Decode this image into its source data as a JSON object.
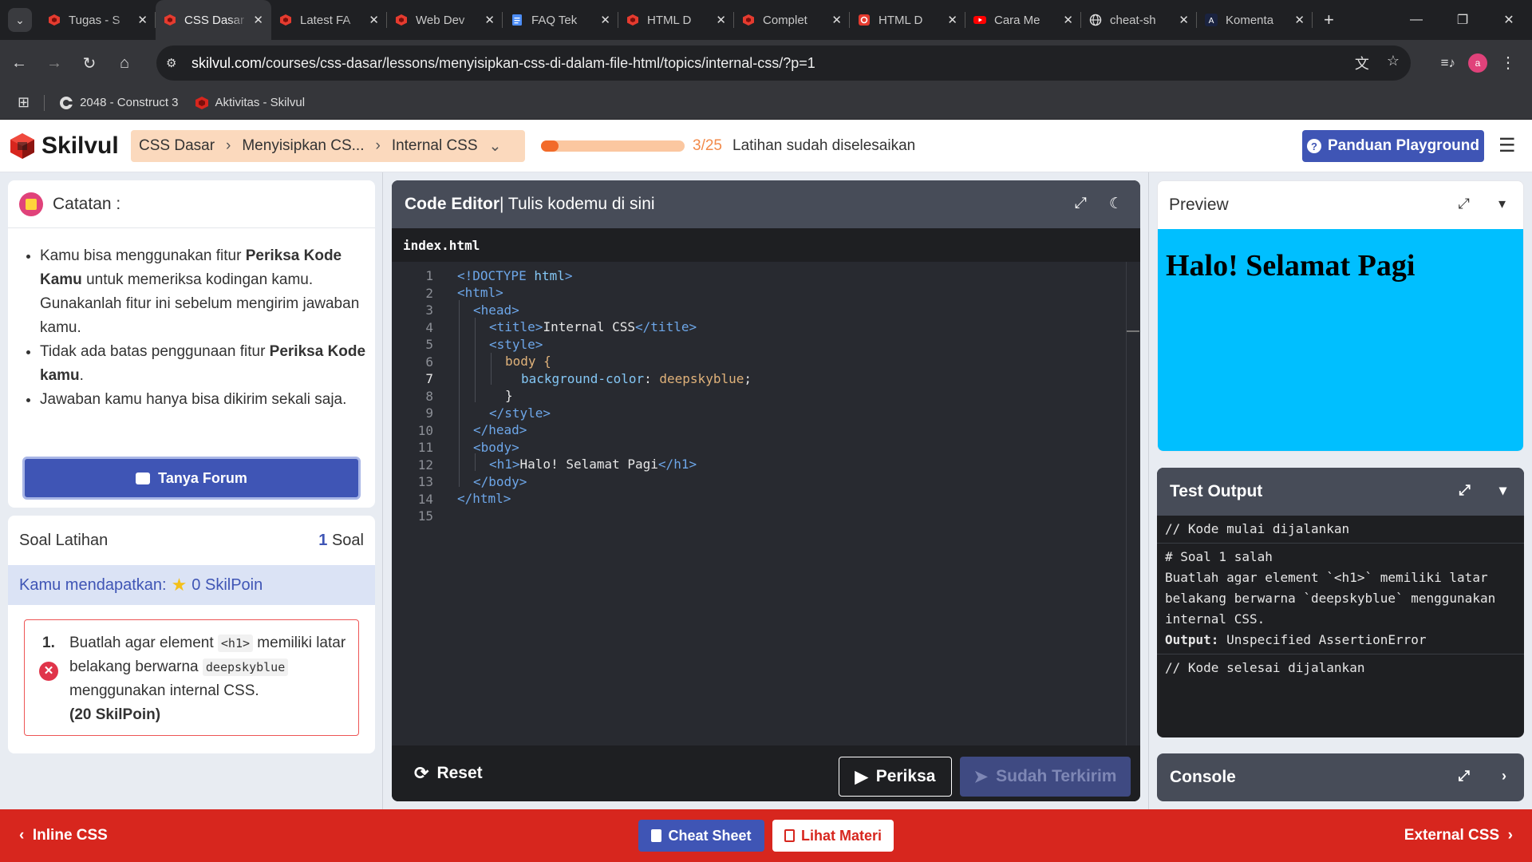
{
  "browser": {
    "tabs": [
      {
        "label": "Tugas - S",
        "icon": "skilvul-icon"
      },
      {
        "label": "CSS Dasar",
        "icon": "skilvul-icon",
        "active": true
      },
      {
        "label": "Latest FA",
        "icon": "skilvul-icon"
      },
      {
        "label": "Web Dev",
        "icon": "skilvul-icon"
      },
      {
        "label": "FAQ Tek",
        "icon": "docs-icon"
      },
      {
        "label": "HTML D",
        "icon": "skilvul-icon"
      },
      {
        "label": "Complet",
        "icon": "skilvul-icon"
      },
      {
        "label": "HTML D",
        "icon": "skilvul-gear-icon"
      },
      {
        "label": "Cara Me",
        "icon": "youtube-icon"
      },
      {
        "label": "cheat-sh",
        "icon": "globe-icon"
      },
      {
        "label": "Komenta",
        "icon": "a-icon"
      }
    ],
    "url_host": "skilvul.com",
    "url_path": "/courses/css-dasar/lessons/menyisipkan-css-di-dalam-file-html/topics/internal-css/?p=1",
    "avatar_letter": "a",
    "bookmarks": [
      {
        "label": "2048 - Construct 3",
        "icon": "construct-icon"
      },
      {
        "label": "Aktivitas - Skilvul",
        "icon": "skilvul-icon"
      }
    ]
  },
  "header": {
    "logo": "Skilvul",
    "breadcrumbs": [
      "CSS Dasar",
      "Menyisipkan CS...",
      "Internal CSS"
    ],
    "progress": {
      "done": 3,
      "total": 25,
      "label": "3/25",
      "text": "Latihan sudah diselesaikan"
    },
    "guide_button": "Panduan Playground"
  },
  "notes": {
    "title": "Catatan :",
    "items": [
      {
        "a": "Kamu bisa menggunakan fitur ",
        "b": "Periksa Kode Kamu",
        "c": " untuk memeriksa kodingan kamu. Gunakanlah fitur ini sebelum mengirim jawaban kamu."
      },
      {
        "a": "Tidak ada batas penggunaan fitur ",
        "b": "Periksa Kode kamu",
        "c": "."
      },
      {
        "a": "Jawaban kamu hanya bisa dikirim sekali saja.",
        "b": "",
        "c": ""
      }
    ],
    "forum_button": "Tanya Forum"
  },
  "exercise": {
    "title": "Soal Latihan",
    "count_num": "1",
    "count_label": " Soal",
    "points_label": "Kamu mendapatkan:",
    "points_value": "0 SkilPoin",
    "task": {
      "number": "1.",
      "text_a": "Buatlah agar element ",
      "code_a": "<h1>",
      "text_b": " memiliki latar belakang berwarna ",
      "code_b": "deepskyblue",
      "text_c": " menggunakan internal CSS.",
      "reward": "(20 SkilPoin)"
    }
  },
  "editor": {
    "title": "Code Editor",
    "subtitle": " | Tulis kodemu di sini",
    "filename": "index.html",
    "lines": [
      "1",
      "2",
      "3",
      "4",
      "5",
      "6",
      "7",
      "8",
      "9",
      "10",
      "11",
      "12",
      "13",
      "14",
      "15"
    ],
    "code": {
      "l1a": "<!DOCTYPE ",
      "l1b": "html",
      "l1c": ">",
      "l2": "<html>",
      "l3": "<head>",
      "l4a": "<title>",
      "l4b": "Internal CSS",
      "l4c": "</title>",
      "l5": "<style>",
      "l6": "body {",
      "l7a": "background-color",
      "l7b": ": ",
      "l7c": "deepskyblue",
      "l7d": ";",
      "l8": "}",
      "l9": "</style>",
      "l10": "</head>",
      "l11": "<body>",
      "l12a": "<h1>",
      "l12b": "Halo! Selamat Pagi",
      "l12c": "</h1>",
      "l13": "</body>",
      "l14": "</html>"
    },
    "reset_label": "Reset",
    "check_label": "Periksa",
    "submitted_label": "Sudah Terkirim"
  },
  "preview": {
    "title": "Preview",
    "heading": "Halo! Selamat Pagi",
    "bg_color": "#00bfff"
  },
  "test_output": {
    "title": "Test Output",
    "start": "// Kode mulai dijalankan",
    "result_title": "# Soal 1 salah",
    "result_text": "Buatlah agar element `<h1>` memiliki latar belakang berwarna `deepskyblue` menggunakan internal CSS.",
    "output_label": "Output:",
    "output_value": " Unspecified AssertionError",
    "end": "// Kode selesai dijalankan"
  },
  "console": {
    "title": "Console"
  },
  "footer": {
    "prev": "Inline CSS",
    "next": "External CSS",
    "cheat_sheet": "Cheat Sheet",
    "view_material": "Lihat Materi"
  },
  "colors": {
    "accent": "#3f55b5",
    "footer": "#d7261e",
    "progress": "#f26b2a"
  }
}
